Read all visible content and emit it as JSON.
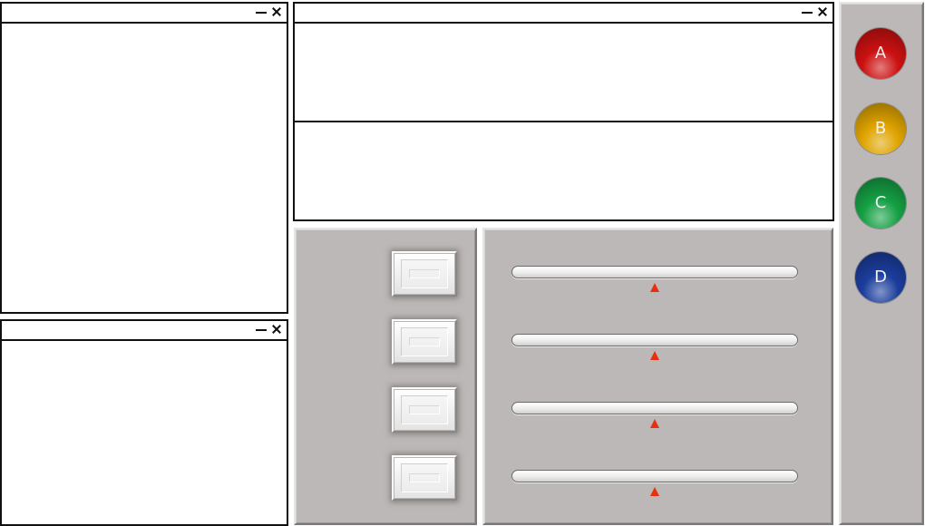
{
  "windows": [
    {
      "id": "left-top-window"
    },
    {
      "id": "left-bottom-window"
    },
    {
      "id": "top-center-window"
    }
  ],
  "button_panel": {
    "buttons": 4
  },
  "slider_panel": {
    "sliders": [
      {
        "value": 0.5
      },
      {
        "value": 0.5
      },
      {
        "value": 0.5
      },
      {
        "value": 0.5
      }
    ]
  },
  "circle_buttons": [
    {
      "label": "A",
      "color": "#cc1111"
    },
    {
      "label": "B",
      "color": "#e0a400"
    },
    {
      "label": "C",
      "color": "#15a044"
    },
    {
      "label": "D",
      "color": "#1b3d9c"
    }
  ],
  "colors": {
    "panel": "#bcb8b7",
    "thumb": "#e8300c",
    "window_border": "#111111"
  }
}
